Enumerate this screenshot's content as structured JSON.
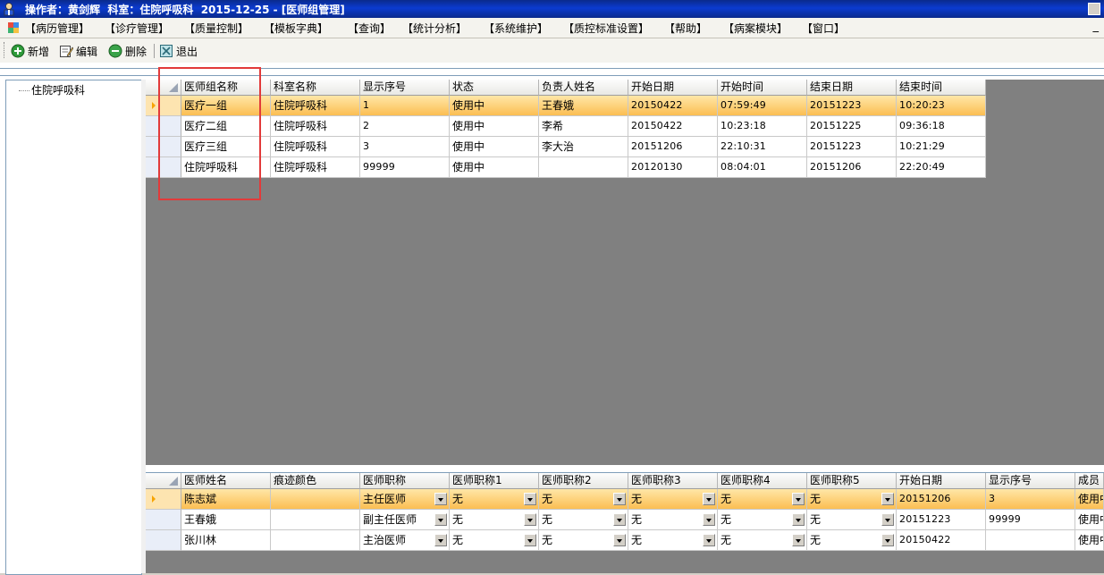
{
  "titlebar": {
    "title": "操作者：黄剑辉  科室：住院呼吸科  2015-12-25 - [医师组管理]"
  },
  "menu": {
    "items": [
      "【病历管理】",
      "【诊疗管理】",
      "【质量控制】",
      "【模板字典】",
      "【查询】",
      "【统计分析】",
      "【系统维护】",
      "【质控标准设置】",
      "【帮助】",
      "【病案模块】",
      "【窗口】"
    ],
    "mdi_min": "_"
  },
  "toolbar": {
    "add_label": "新增",
    "edit_label": "编辑",
    "delete_label": "删除",
    "exit_label": "退出"
  },
  "tree": {
    "root_label": "住院呼吸科"
  },
  "upper_grid": {
    "columns": [
      "医师组名称",
      "科室名称",
      "显示序号",
      "状态",
      "负责人姓名",
      "开始日期",
      "开始时间",
      "结束日期",
      "结束时间"
    ],
    "rows": [
      [
        "医疗一组",
        "住院呼吸科",
        "1",
        "使用中",
        "王春娥",
        "20150422",
        "07:59:49",
        "20151223",
        "10:20:23"
      ],
      [
        "医疗二组",
        "住院呼吸科",
        "2",
        "使用中",
        "李希",
        "20150422",
        "10:23:18",
        "20151225",
        "09:36:18"
      ],
      [
        "医疗三组",
        "住院呼吸科",
        "3",
        "使用中",
        "李大治",
        "20151206",
        "22:10:31",
        "20151223",
        "10:21:29"
      ],
      [
        "住院呼吸科",
        "住院呼吸科",
        "99999",
        "使用中",
        "",
        "20120130",
        "08:04:01",
        "20151206",
        "22:20:49"
      ]
    ],
    "selected_row": 0
  },
  "lower_grid": {
    "columns": [
      "医师姓名",
      "痕迹颜色",
      "医师职称",
      "医师职称1",
      "医师职称2",
      "医师职称3",
      "医师职称4",
      "医师职称5",
      "开始日期",
      "显示序号",
      "成员"
    ],
    "rows": [
      [
        "陈志斌",
        "",
        "主任医师",
        "无",
        "无",
        "无",
        "无",
        "无",
        "20151206",
        "3",
        "使用中"
      ],
      [
        "王春娥",
        "",
        "副主任医师",
        "无",
        "无",
        "无",
        "无",
        "无",
        "20151223",
        "99999",
        "使用中"
      ],
      [
        "张川林",
        "",
        "主治医师",
        "无",
        "无",
        "无",
        "无",
        "无",
        "20150422",
        "",
        "使用中"
      ]
    ],
    "selected_row": 0
  },
  "colors": {
    "highlight_box": "#e23a3a",
    "selected_row": "#fbbe52",
    "grid_background": "#808080",
    "titlebar": "#0b3bd0"
  }
}
